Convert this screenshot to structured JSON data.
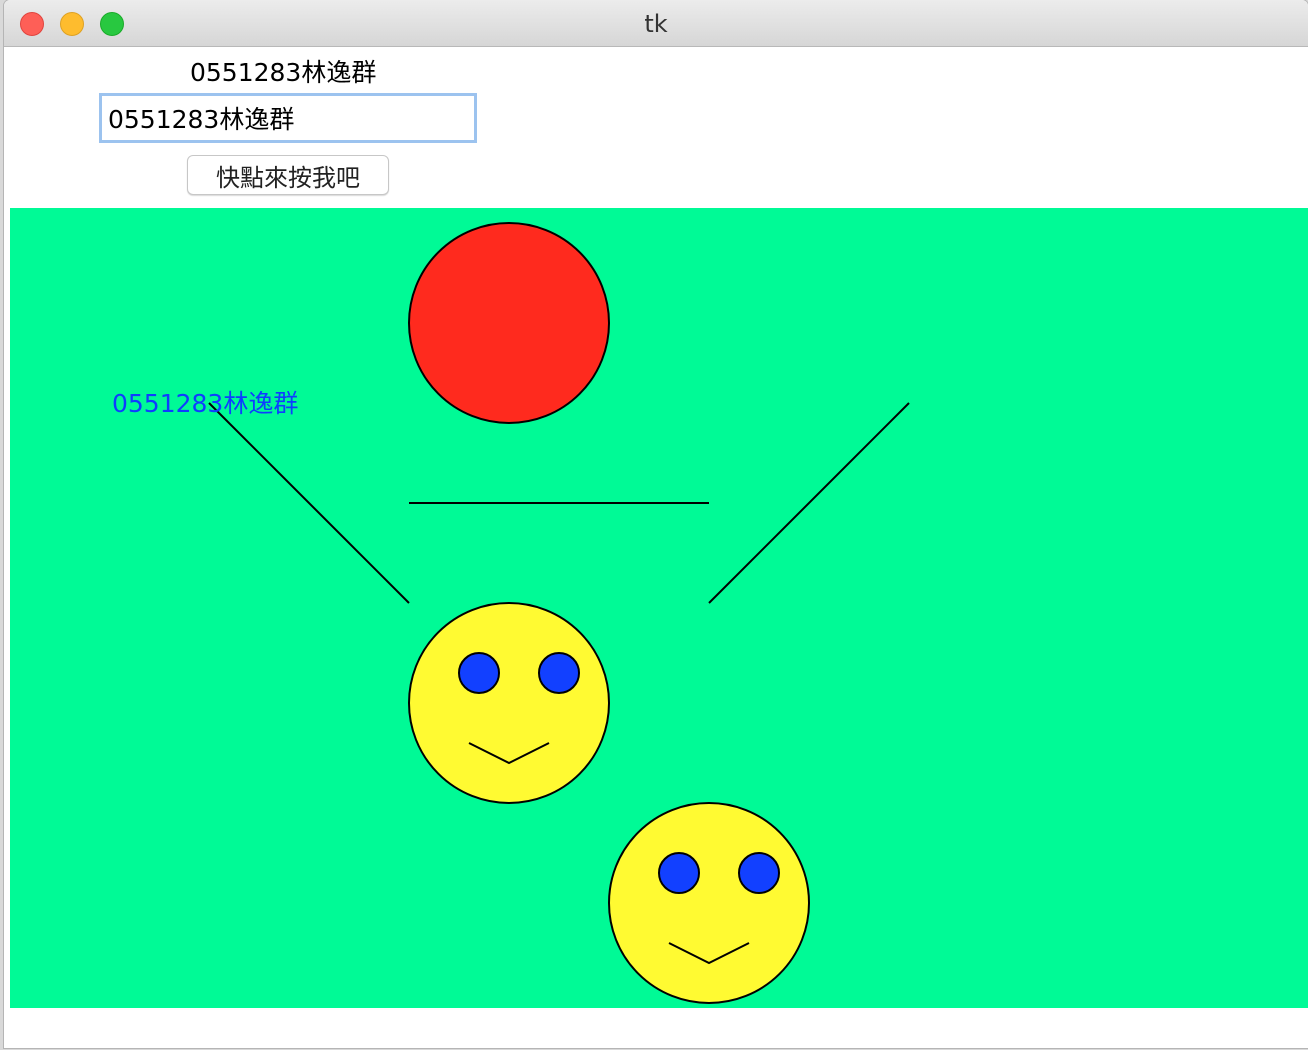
{
  "window": {
    "title": "tk"
  },
  "label": {
    "text": "0551283林逸群"
  },
  "entry": {
    "value": "0551283林逸群"
  },
  "button": {
    "label": "快點來按我吧"
  },
  "canvas": {
    "background": "#00fa96",
    "text": "0551283林逸群",
    "text_color": "#0f3dff",
    "ball_color": "#ff2a1e",
    "face_color": "#fffa32",
    "eye_color": "#1240ff"
  }
}
